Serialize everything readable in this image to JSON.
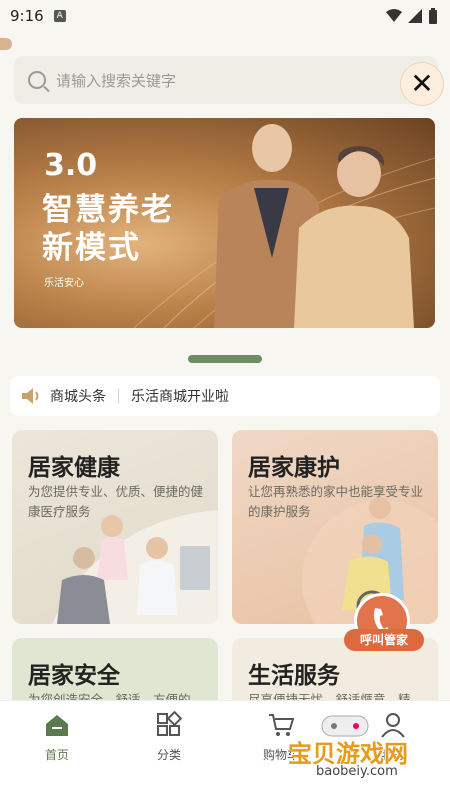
{
  "status_bar": {
    "time": "9:16",
    "notification_badge": "A"
  },
  "search": {
    "placeholder": "请输入搜索关键字"
  },
  "banner": {
    "version": "3.0",
    "headline_line1": "智慧养老",
    "headline_line2": "新模式",
    "tagline": "乐活安心"
  },
  "news": {
    "label": "商城头条",
    "text": "乐活商城开业啦"
  },
  "cards": [
    {
      "title": "居家健康",
      "subtitle": "为您提供专业、优质、便捷的健康医疗服务"
    },
    {
      "title": "居家康护",
      "subtitle": "让您再熟悉的家中也能享受专业的康护服务"
    },
    {
      "title": "居家安全",
      "subtitle": "为您创造安全、舒适、方便的"
    },
    {
      "title": "生活服务",
      "subtitle": "尽享便捷无忧、舒适惬意、精"
    }
  ],
  "call_button": {
    "label": "呼叫管家"
  },
  "tabbar": {
    "items": [
      {
        "label": "首页",
        "icon": "home-icon",
        "active": true
      },
      {
        "label": "分类",
        "icon": "category-icon",
        "active": false
      },
      {
        "label": "购物车",
        "icon": "cart-icon",
        "active": false
      },
      {
        "label": "我的",
        "icon": "user-icon",
        "active": false
      }
    ]
  },
  "watermark": {
    "title": "宝贝游戏网",
    "url": "baobeiy.com"
  },
  "colors": {
    "accent": "#5a7a4e",
    "indicator": "#6f8c65",
    "call": "#dd6a3f"
  }
}
